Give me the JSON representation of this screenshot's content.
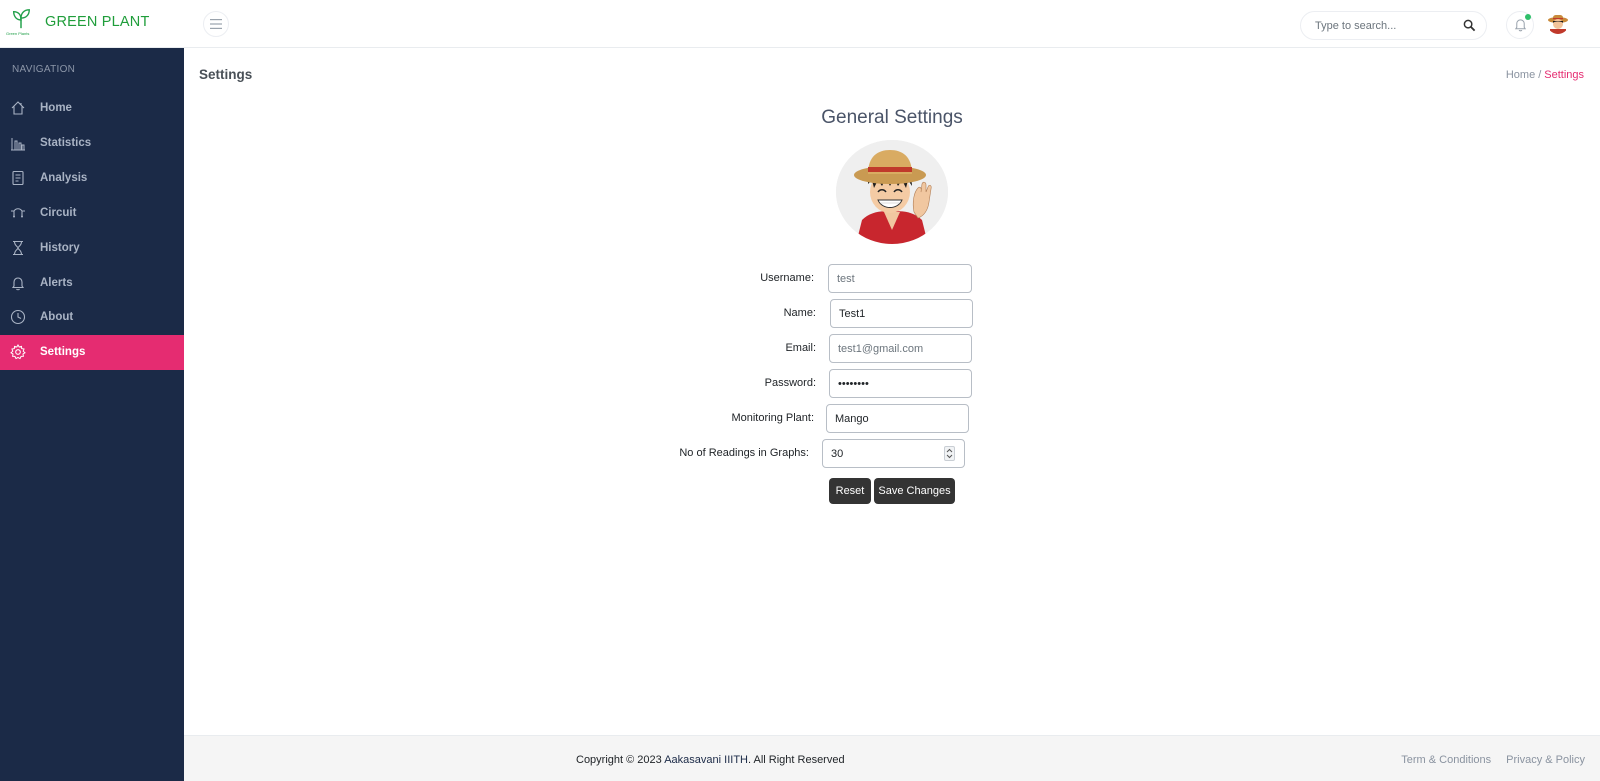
{
  "app": {
    "brand": "GREEN PLANT",
    "logo_tagline": "Green Plants"
  },
  "topbar": {
    "search_placeholder": "Type to search..."
  },
  "sidebar": {
    "heading": "NAVIGATION",
    "items": [
      {
        "label": "Home",
        "icon": "home-icon"
      },
      {
        "label": "Statistics",
        "icon": "bar-chart-icon"
      },
      {
        "label": "Analysis",
        "icon": "document-icon"
      },
      {
        "label": "Circuit",
        "icon": "circuit-icon"
      },
      {
        "label": "History",
        "icon": "hourglass-icon"
      },
      {
        "label": "Alerts",
        "icon": "bell-icon"
      },
      {
        "label": "About",
        "icon": "clock-icon"
      },
      {
        "label": "Settings",
        "icon": "gear-icon",
        "active": true
      }
    ]
  },
  "page": {
    "title": "Settings",
    "breadcrumb": {
      "home": "Home",
      "separator": "/",
      "current": "Settings"
    }
  },
  "settings": {
    "heading": "General Settings",
    "fields": {
      "username": {
        "label": "Username:",
        "value": "test"
      },
      "name": {
        "label": "Name:",
        "value": "Test1"
      },
      "email": {
        "label": "Email:",
        "value": "test1@gmail.com"
      },
      "password": {
        "label": "Password:",
        "value": "password"
      },
      "plant": {
        "label": "Monitoring Plant:",
        "value": "Mango"
      },
      "readings": {
        "label": "No of Readings in Graphs:",
        "value": "30"
      }
    },
    "reset_label": "Reset",
    "save_label": "Save Changes"
  },
  "footer": {
    "copyright_prefix": "Copyright © 2023 ",
    "copyright_org": "Aakasavani IIITH",
    "copyright_suffix": ". All Right Reserved",
    "terms": "Term & Conditions",
    "privacy": "Privacy & Policy"
  },
  "colors": {
    "accent": "#e52c71",
    "sidebar_bg": "#1b2a47",
    "brand": "#1f9d3a",
    "button": "#343434"
  }
}
